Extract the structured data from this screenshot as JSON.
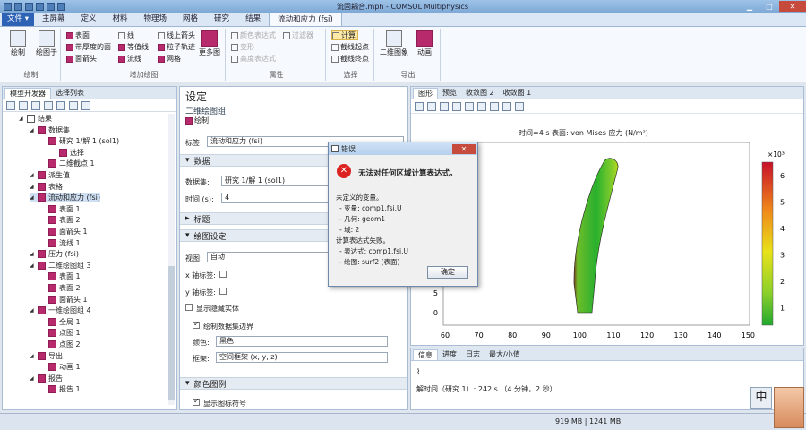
{
  "window": {
    "title": "流固耦合.mph - COMSOL Multiphysics"
  },
  "ribbon_tabs": [
    "文件 ▾",
    "主屏幕",
    "定义",
    "材料",
    "物理场",
    "网格",
    "研究",
    "结果",
    "流动和应力 (fsi)"
  ],
  "ribbon": {
    "draw": "绘制",
    "draw_in": "绘图于",
    "group_draw": "绘制",
    "surface": "表面",
    "line": "线",
    "line_arrow": "线上箭头",
    "height_surface": "带厚度的面",
    "contour": "等值线",
    "particle_track": "粒子轨迹",
    "surface_arrow": "面箭头",
    "streamline": "流线",
    "mesh": "网格",
    "more_plots": "更多图",
    "group_add": "增加绘图",
    "color_expr": "颜色表达式",
    "filter": "过滤器",
    "deform": "变形",
    "height_expr": "高度表达式",
    "group_attr": "属性",
    "calc": "计算",
    "cutline_start": "截线起点",
    "cutline_end": "截线终点",
    "group_select": "选择",
    "image_2d": "二维图象",
    "animation": "动画",
    "group_export": "导出"
  },
  "model_builder": {
    "tab1": "模型开发器",
    "tab2": "选择列表",
    "tree": [
      {
        "label": "结果",
        "indent": 0
      },
      {
        "label": "数据集",
        "indent": 1
      },
      {
        "label": "研究 1/解 1 (sol1)",
        "indent": 2
      },
      {
        "label": "选择",
        "indent": 3
      },
      {
        "label": "二维截点 1",
        "indent": 2
      },
      {
        "label": "派生值",
        "indent": 1
      },
      {
        "label": "表格",
        "indent": 1
      },
      {
        "label": "流动和应力 (fsi)",
        "indent": 1
      },
      {
        "label": "表面 1",
        "indent": 2
      },
      {
        "label": "表面 2",
        "indent": 2
      },
      {
        "label": "面箭头 1",
        "indent": 2
      },
      {
        "label": "流线 1",
        "indent": 2
      },
      {
        "label": "压力 (fsi)",
        "indent": 1
      },
      {
        "label": "二维绘图组 3",
        "indent": 1
      },
      {
        "label": "表面 1",
        "indent": 2
      },
      {
        "label": "表面 2",
        "indent": 2
      },
      {
        "label": "面箭头 1",
        "indent": 2
      },
      {
        "label": "一维绘图组 4",
        "indent": 1
      },
      {
        "label": "全局 1",
        "indent": 2
      },
      {
        "label": "点图 1",
        "indent": 2
      },
      {
        "label": "点图 2",
        "indent": 2
      },
      {
        "label": "导出",
        "indent": 1
      },
      {
        "label": "动画 1",
        "indent": 2
      },
      {
        "label": "报告",
        "indent": 1
      },
      {
        "label": "报告 1",
        "indent": 2
      }
    ]
  },
  "settings": {
    "title": "设定",
    "subtitle": "二维绘图组",
    "draw": "绘制",
    "label_lbl": "标签:",
    "label_val": "流动和应力 (fsi)",
    "sec_data": "数据",
    "dataset_lbl": "数据集:",
    "dataset_val": "研究 1/解 1 (sol1)",
    "time_lbl": "时间 (s):",
    "time_val": "4",
    "sec_title": "标题",
    "sec_plot": "绘图设定",
    "view_lbl": "视图:",
    "view_val": "自动",
    "xaxis_lbl": "x 轴标签:",
    "yaxis_lbl": "y 轴标签:",
    "hidden_lbl": "显示隐藏实体",
    "boundary_lbl": "绘制数据集边界",
    "color_lbl": "颜色:",
    "color_val": "黑色",
    "frame_lbl": "框架:",
    "frame_val": "空间框架 (x, y, z)",
    "sec_legend": "颜色图例",
    "show_legend": "显示图标符号"
  },
  "graphics": {
    "tabs": [
      "图形",
      "预览",
      "收敛图 2",
      "收敛图 1"
    ],
    "plot_title": "时间=4 s   表面: von Mises 应力 (N/m²)",
    "xticks": [
      "60",
      "70",
      "80",
      "90",
      "100",
      "110",
      "120",
      "130",
      "140",
      "150"
    ],
    "yticks": [
      "0",
      "5"
    ],
    "cb_exp": "×10³",
    "cb_ticks": [
      "6",
      "5",
      "4",
      "3",
      "2",
      "1"
    ]
  },
  "dialog": {
    "title": "错误",
    "main": "无法对任何区域计算表达式。",
    "lines": [
      "未定义的变量。",
      "- 变量: comp1.fsi.U",
      "- 几何: geom1",
      "- 域: 2",
      "计算表达式失败。",
      "- 表达式: comp1.fsi.U",
      "- 绘图: surf2 (表面)"
    ],
    "ok": "确定"
  },
  "log": {
    "tabs": [
      "信息",
      "进度",
      "日志",
      "最大/小值"
    ],
    "message": "解时间（研究 1）: 242 s （4 分钟，2 秒）"
  },
  "status": {
    "memory": "919 MB | 1241 MB"
  },
  "ime": {
    "char": "中"
  },
  "colors": {
    "accent": "#b72a6c",
    "file_tab": "#2d62b4"
  }
}
